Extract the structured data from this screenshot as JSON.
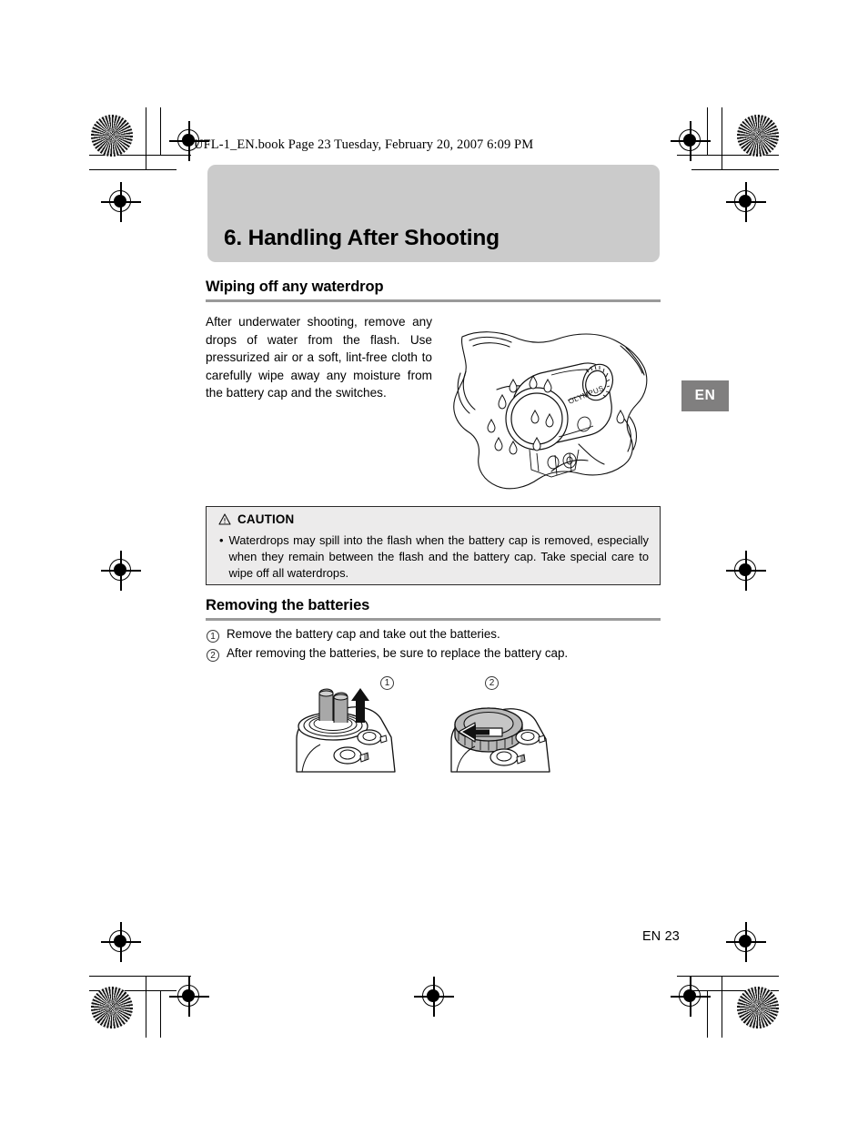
{
  "running_header": "UFL-1_EN.book  Page 23  Tuesday, February 20, 2007  6:09 PM",
  "chapter": {
    "title": "6. Handling After Shooting",
    "band_color": "#cbcbcb"
  },
  "sections": [
    {
      "heading": "Wiping off any waterdrop",
      "body": "After underwater shooting, remove any drops of water from the flash. Use pressurized air or a soft, lint-free cloth to carefully wipe away any moisture from the battery cap and the switches."
    },
    {
      "heading": "Removing the batteries"
    }
  ],
  "caution": {
    "icon": "warning-triangle-icon",
    "label": "CAUTION",
    "bullet": "•",
    "text": "Waterdrops may spill into the flash when the battery cap is removed, especially when they remain between the flash and the battery cap. Take special care to wipe off all waterdrops.",
    "fill_color": "#ecebeb",
    "border_color": "#2a2a2a"
  },
  "steps": [
    {
      "num": "1",
      "text": "Remove the battery cap and take out the batteries."
    },
    {
      "num": "2",
      "text": "After removing the batteries, be sure to replace the battery cap."
    }
  ],
  "diagram_labels": [
    {
      "num": "1"
    },
    {
      "num": "2"
    }
  ],
  "side_tab": {
    "label": "EN",
    "color": "#807f7f"
  },
  "footer": {
    "folio": "EN 23"
  },
  "illustrations": {
    "main": "underwater-flash-on-cloth-with-waterdrops",
    "step1": "battery-cap-removed-batteries-pulled-up",
    "step2": "battery-cap-being-screwed-back-on"
  }
}
